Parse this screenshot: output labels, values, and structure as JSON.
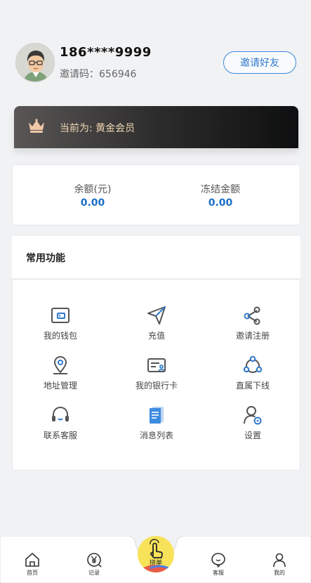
{
  "profile": {
    "phone": "186****9999",
    "invite_code": "邀请码：656946",
    "invite_button": "邀请好友"
  },
  "vip": {
    "label": "当前为: 黄金会员",
    "icon": "crown-icon"
  },
  "balance": {
    "left_label": "余额(元)",
    "left_value": "0.00",
    "right_label": "冻结金额",
    "right_value": "0.00"
  },
  "functions": {
    "title": "常用功能",
    "items": [
      {
        "label": "我的钱包",
        "icon": "wallet-icon"
      },
      {
        "label": "充值",
        "icon": "send-icon"
      },
      {
        "label": "邀请注册",
        "icon": "share-icon"
      },
      {
        "label": "地址管理",
        "icon": "location-icon"
      },
      {
        "label": "我的银行卡",
        "icon": "bank-card-icon"
      },
      {
        "label": "直属下线",
        "icon": "network-icon"
      },
      {
        "label": "联系客服",
        "icon": "headset-icon"
      },
      {
        "label": "消息列表",
        "icon": "document-icon"
      },
      {
        "label": "设置",
        "icon": "user-settings-icon"
      }
    ]
  },
  "tabbar": {
    "home": "首页",
    "records": "记录",
    "center": "拼单",
    "service": "客服",
    "mine": "我的"
  },
  "colors": {
    "accent_blue": "#2f79cc",
    "value_blue": "#1a6fc4",
    "vip_gold": "#f1d7b4",
    "center_yellow": "#f7e25a"
  }
}
